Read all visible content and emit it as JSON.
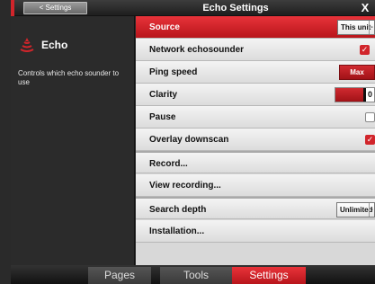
{
  "titlebar": {
    "back_label": "< Settings",
    "title": "Echo Settings",
    "close_label": "X"
  },
  "left_panel": {
    "icon": "echo-sonar-icon",
    "heading": "Echo",
    "description": "Controls which echo sounder to use"
  },
  "rows": [
    {
      "label": "Source",
      "control": "dropdown",
      "value": "This unit",
      "selected": true
    },
    {
      "label": "Network echosounder",
      "control": "checkbox",
      "checked": true
    },
    {
      "label": "Ping speed",
      "control": "button",
      "value": "Max"
    },
    {
      "label": "Clarity",
      "control": "slider",
      "value": "0"
    },
    {
      "label": "Pause",
      "control": "checkbox",
      "checked": false
    },
    {
      "label": "Overlay downscan",
      "control": "checkbox",
      "checked": true
    },
    {
      "label": "Record...",
      "control": "none"
    },
    {
      "label": "View recording...",
      "control": "none"
    },
    {
      "label": "Search depth",
      "control": "dropdown",
      "value": "Unlimited"
    },
    {
      "label": "Installation...",
      "control": "none"
    }
  ],
  "bottom_tabs": [
    {
      "label": "Pages"
    },
    {
      "label": "Tools"
    },
    {
      "label": "Settings",
      "active": true
    }
  ],
  "colors": {
    "accent": "#d1252b",
    "panel": "#2b2b2b",
    "row": "#ececec"
  }
}
